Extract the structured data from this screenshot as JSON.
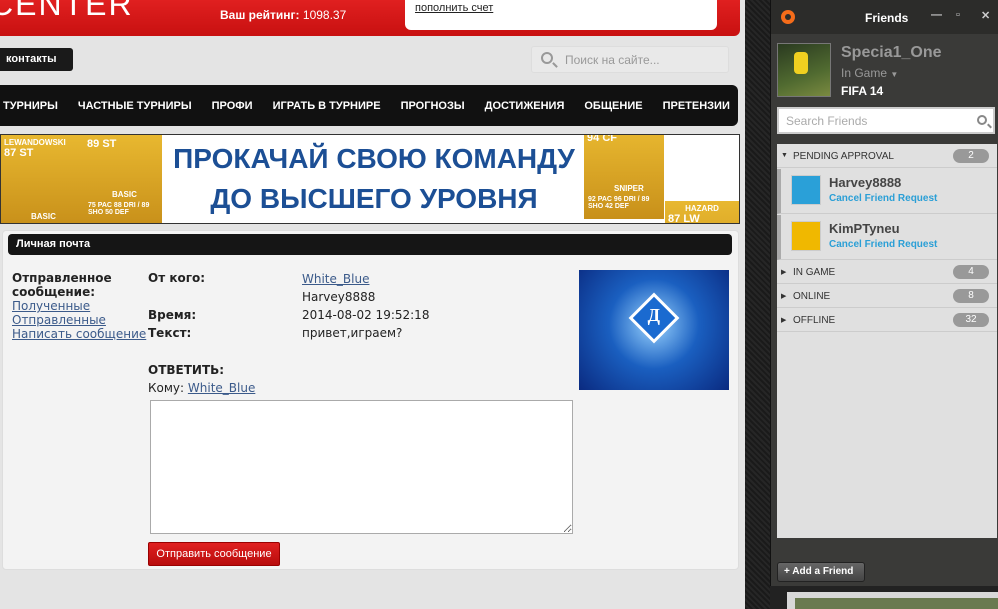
{
  "site": {
    "logo": "CENTER",
    "rating_label": "Ваш рейтинг:",
    "rating_value": "1098.37",
    "account_link": "пополнить счет",
    "contacts": "контакты",
    "search_placeholder": "Поиск на сайте...",
    "nav": [
      "ТУРНИРЫ",
      "ЧАСТНЫЕ ТУРНИРЫ",
      "ПРОФИ",
      "ИГРАТЬ В ТУРНИРЕ",
      "ПРОГНОЗЫ",
      "ДОСТИЖЕНИЯ",
      "ОБЩЕНИЕ",
      "ПРЕТЕНЗИИ"
    ],
    "banner": {
      "line1": "ПРОКАЧАЙ СВОЮ КОМАНДУ",
      "line2": "ДО ВЫСШЕГО УРОВНЯ",
      "cards": [
        {
          "name": "LEWANDOWSKI",
          "rating": "87",
          "pos": "ST",
          "type": "BASIC"
        },
        {
          "rating": "89",
          "pos": "ST",
          "type": "BASIC",
          "stats": "75 PAC 88 DRI / 89 SHO 50 DEF"
        },
        {
          "rating": "94",
          "pos": "CF",
          "type": "SNIPER",
          "stats": "92 PAC 96 DRI / 89 SHO 42 DEF"
        },
        {
          "name": "HAZARD",
          "rating": "87",
          "pos": "LW"
        }
      ]
    }
  },
  "mail": {
    "title": "Личная почта",
    "current": "Отправленное сообщение:",
    "links": [
      "Полученные",
      "Отправленные",
      "Написать сообщение"
    ],
    "from_label": "От кого:",
    "from": "White_Blue",
    "to": "Harvey8888",
    "time_label": "Время:",
    "time": "2014-08-02 19:52:18",
    "text_label": "Текст:",
    "text": "привет,играем?",
    "reply_label": "ОТВЕТИТЬ:",
    "to_label": "Кому:",
    "reply_to": "White_Blue",
    "reply_value": "",
    "send": "Отправить сообщение"
  },
  "origin": {
    "title": "Friends",
    "user": "Specia1_One",
    "status": "In Game",
    "game": "FIFA 14",
    "search_placeholder": "Search Friends",
    "pending": {
      "label": "PENDING APPROVAL",
      "count": "2",
      "items": [
        {
          "name": "Harvey8888",
          "action": "Cancel Friend Request"
        },
        {
          "name": "KimPTyneu",
          "action": "Cancel Friend Request"
        }
      ]
    },
    "groups": [
      {
        "label": "IN GAME",
        "count": "4"
      },
      {
        "label": "ONLINE",
        "count": "8"
      },
      {
        "label": "OFFLINE",
        "count": "32"
      }
    ],
    "add_friend": "Add a Friend",
    "accent": "#f56c1a",
    "link_color": "#2a9fd6"
  }
}
